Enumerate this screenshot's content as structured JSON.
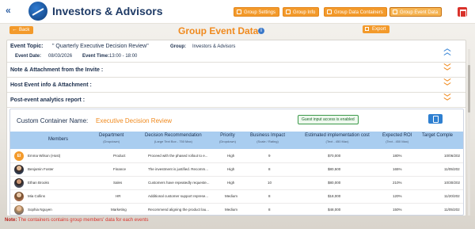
{
  "header": {
    "title": "Investors & Advisors",
    "buttons": [
      {
        "label": "Group Settings"
      },
      {
        "label": "Group Info"
      },
      {
        "label": "Group Data Containers"
      },
      {
        "label": "Group Event Data"
      }
    ]
  },
  "subheader": {
    "back_label": "Back",
    "page_title": "Group Event Data",
    "info_glyph": "i",
    "export_label": "Export"
  },
  "event": {
    "topic_label": "Event Topic:",
    "topic_value": "\" Quarterly Executive Decision Review\"",
    "group_label": "Group:",
    "group_value": "Investors & Advisors",
    "date_label": "Event Date:",
    "date_value": "08/03/2026",
    "time_label": "Event Time:",
    "time_value": "13:00 - 18:00"
  },
  "sections": [
    {
      "label": "Note & Attachment from the Invite :"
    },
    {
      "label": "Host Event info & Attachment :"
    },
    {
      "label": "Post-event analytics report :"
    }
  ],
  "container": {
    "label": "Custom Container Name:",
    "name": "Executive Decision Review",
    "guest_badge": "Guest input access is enabled",
    "columns": [
      {
        "title": "Members",
        "sub": ""
      },
      {
        "title": "Department",
        "sub": "(Dropdown)"
      },
      {
        "title": "Decision Recommendation",
        "sub": "(Large Text Box - 750 Max)"
      },
      {
        "title": "Priority",
        "sub": "(Dropdown)"
      },
      {
        "title": "Business Impact",
        "sub": "(Scale / Rating)"
      },
      {
        "title": "Estimated implementation cost",
        "sub": "(Text - 450 Max)"
      },
      {
        "title": "Expected ROI",
        "sub": "(Text - 450 Max)"
      },
      {
        "title": "Target Comple",
        "sub": ""
      }
    ],
    "rows": [
      {
        "member": "Emma Wilson (Host)",
        "initial": "EI",
        "dept": "Product",
        "rec": "Proceed with the phased rollout to e...",
        "priority": "High",
        "impact": "9",
        "cost": "$70,000",
        "roi": "180%",
        "target": "10/06/202"
      },
      {
        "member": "Benjamin Foster",
        "initial": "",
        "dept": "Finance",
        "rec": "The investment is justified. Recomm...",
        "priority": "High",
        "impact": "8",
        "cost": "$80,500",
        "roi": "165%",
        "target": "11/05/202"
      },
      {
        "member": "Ethan Brooks",
        "initial": "",
        "dept": "Sales",
        "rec": "Customers have repeatedly requeste...",
        "priority": "High",
        "impact": "10",
        "cost": "$80,000",
        "roi": "210%",
        "target": "10/30/202"
      },
      {
        "member": "Mia Collins",
        "initial": "",
        "dept": "HR",
        "rec": "Additional customer support represe...",
        "priority": "Medium",
        "impact": "8",
        "cost": "$18,000",
        "roi": "120%",
        "target": "11/20/202"
      },
      {
        "member": "Sophia Nguyen",
        "initial": "",
        "dept": "Marketing",
        "rec": "Recommend aligning the product lau...",
        "priority": "Medium",
        "impact": "8",
        "cost": "$48,000",
        "roi": "150%",
        "target": "11/05/202"
      }
    ]
  },
  "note": {
    "prefix": "Note:",
    "text": " The containers contains group members' data for each events"
  }
}
